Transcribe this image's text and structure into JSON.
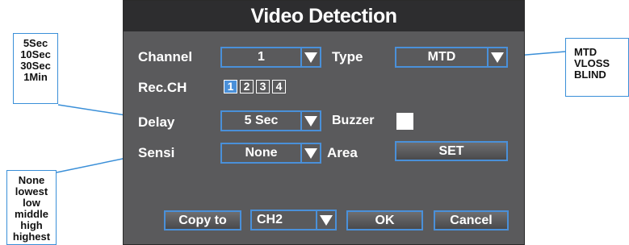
{
  "dialog": {
    "title": "Video Detection",
    "channel": {
      "label": "Channel",
      "value": "1"
    },
    "type": {
      "label": "Type",
      "value": "MTD"
    },
    "rec_ch": {
      "label": "Rec.CH",
      "channels": [
        "1",
        "2",
        "3",
        "4"
      ],
      "selected": "1"
    },
    "delay": {
      "label": "Delay",
      "value": "5 Sec"
    },
    "buzzer": {
      "label": "Buzzer",
      "checked": false
    },
    "sensi": {
      "label": "Sensi",
      "value": "None"
    },
    "area": {
      "label": "Area",
      "button": "SET"
    },
    "copy_to": {
      "button": "Copy to",
      "value": "CH2"
    },
    "ok_button": "OK",
    "cancel_button": "Cancel"
  },
  "callouts": {
    "delay_options": [
      "5Sec",
      "10Sec",
      "30Sec",
      "1Min"
    ],
    "sensi_options": [
      "None",
      "lowest",
      "low",
      "middle",
      "high",
      "highest"
    ],
    "type_options": [
      "MTD",
      "VLOSS",
      "BLIND"
    ]
  },
  "colors": {
    "panel": "#5a5a5c",
    "title_bar": "#2d2d2f",
    "accent": "#4a90d9",
    "text": "#ffffff"
  },
  "icons": {
    "dropdown": "triangle-down-icon"
  }
}
